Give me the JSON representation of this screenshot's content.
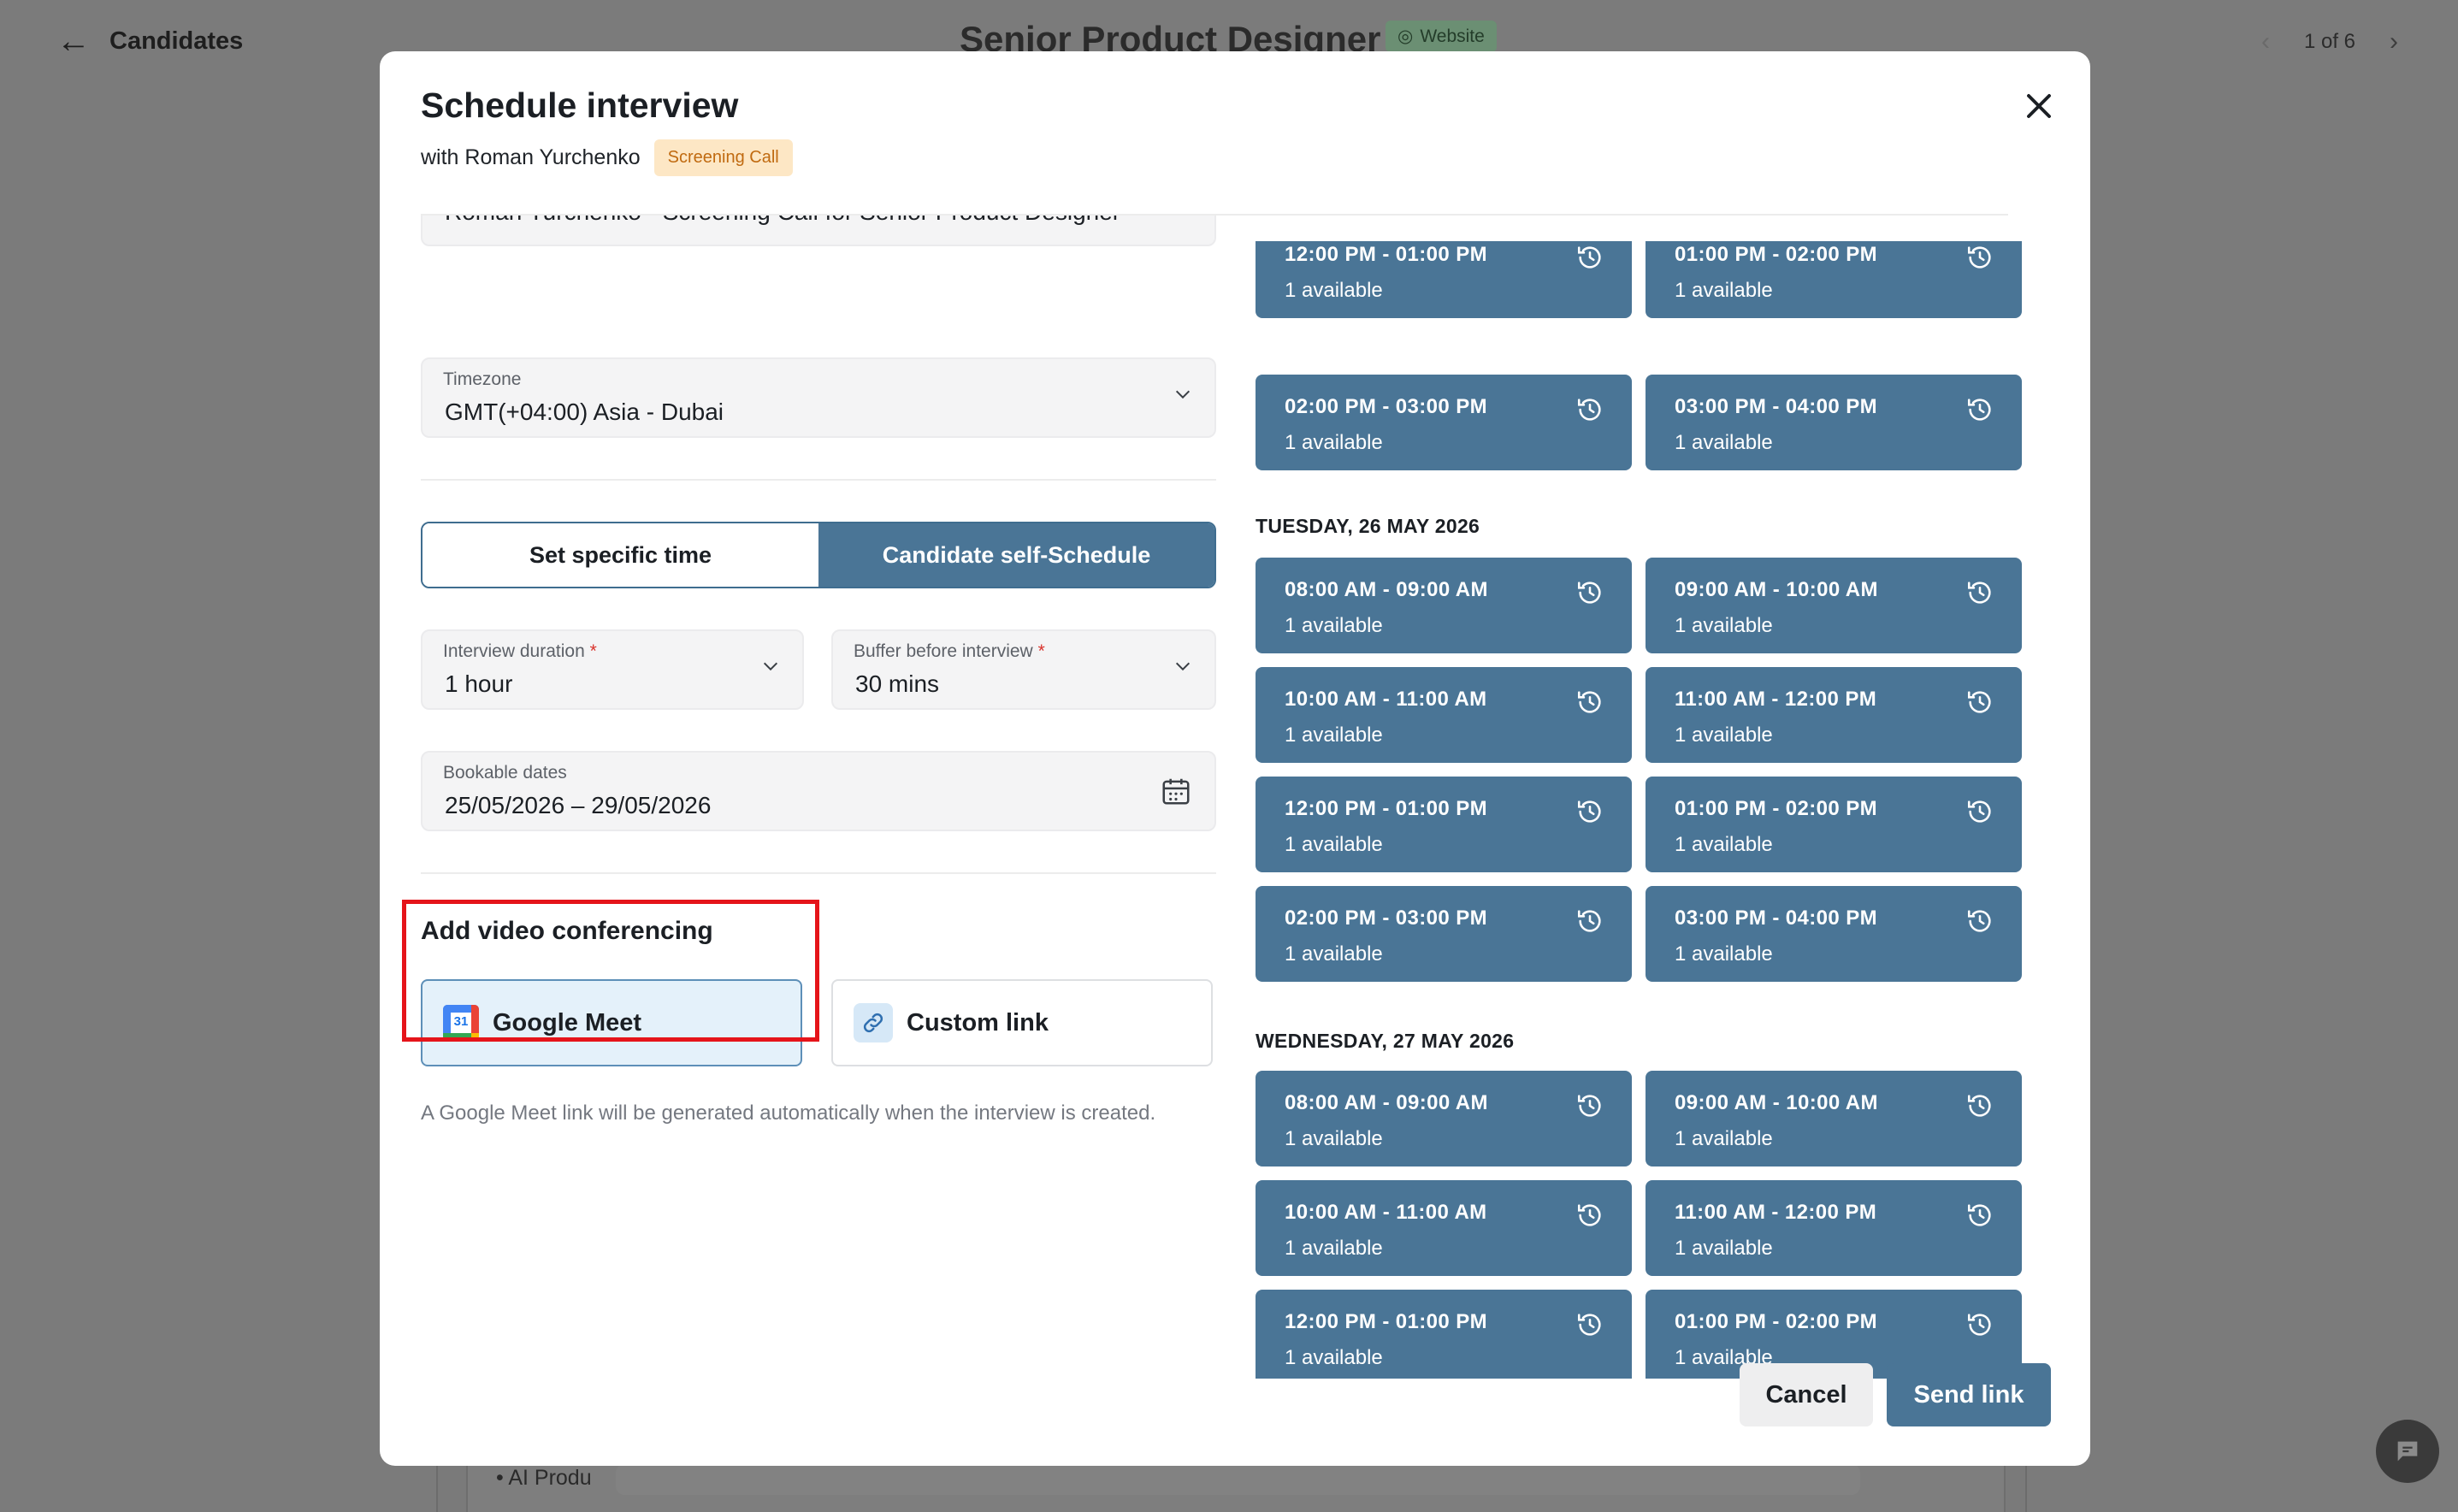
{
  "background": {
    "back_label": "Candidates",
    "page_title": "Senior Product Designer",
    "source_badge": "Website",
    "pager": "1 of 6",
    "bullet_text": "AI Produ"
  },
  "modal": {
    "title": "Schedule interview",
    "with_text": "with Roman Yurchenko",
    "stage_tag": "Screening Call",
    "subject_value": "Roman Yurchenko - Screening Call for Senior Product Designer",
    "timezone": {
      "label": "Timezone",
      "value": "GMT(+04:00) Asia - Dubai"
    },
    "mode_options": {
      "specific": "Set specific time",
      "self": "Candidate self-Schedule",
      "selected": "self"
    },
    "duration": {
      "label": "Interview duration",
      "required": "*",
      "value": "1 hour"
    },
    "buffer": {
      "label": "Buffer before interview",
      "required": "*",
      "value": "30 mins"
    },
    "bookable": {
      "label": "Bookable dates",
      "value": "25/05/2026 – 29/05/2026"
    },
    "video": {
      "title": "Add video conferencing",
      "google_label": "Google Meet",
      "google_icon_text": "31",
      "custom_label": "Custom link",
      "help": "A Google Meet link will be generated automatically when the interview is created.",
      "selected": "google"
    },
    "cancel_label": "Cancel",
    "send_label": "Send link"
  },
  "slots": {
    "partial": [
      {
        "time": "12:00 PM - 01:00 PM",
        "avail": "1 available"
      },
      {
        "time": "01:00 PM - 02:00 PM",
        "avail": "1 available"
      },
      {
        "time": "02:00 PM - 03:00 PM",
        "avail": "1 available"
      },
      {
        "time": "03:00 PM - 04:00 PM",
        "avail": "1 available"
      }
    ],
    "tuesday": {
      "title": "TUESDAY, 26 MAY 2026",
      "items": [
        {
          "time": "08:00 AM - 09:00 AM",
          "avail": "1 available"
        },
        {
          "time": "09:00 AM - 10:00 AM",
          "avail": "1 available"
        },
        {
          "time": "10:00 AM - 11:00 AM",
          "avail": "1 available"
        },
        {
          "time": "11:00 AM - 12:00 PM",
          "avail": "1 available"
        },
        {
          "time": "12:00 PM - 01:00 PM",
          "avail": "1 available"
        },
        {
          "time": "01:00 PM - 02:00 PM",
          "avail": "1 available"
        },
        {
          "time": "02:00 PM - 03:00 PM",
          "avail": "1 available"
        },
        {
          "time": "03:00 PM - 04:00 PM",
          "avail": "1 available"
        }
      ]
    },
    "wednesday": {
      "title": "WEDNESDAY, 27 MAY 2026",
      "items": [
        {
          "time": "08:00 AM - 09:00 AM",
          "avail": "1 available"
        },
        {
          "time": "09:00 AM - 10:00 AM",
          "avail": "1 available"
        },
        {
          "time": "10:00 AM - 11:00 AM",
          "avail": "1 available"
        },
        {
          "time": "11:00 AM - 12:00 PM",
          "avail": "1 available"
        },
        {
          "time": "12:00 PM - 01:00 PM",
          "avail": "1 available"
        },
        {
          "time": "01:00 PM - 02:00 PM",
          "avail": "1 available"
        }
      ]
    }
  },
  "colors": {
    "accent": "#4a7596",
    "tag_bg": "#fde7c5",
    "tag_text": "#c06a10",
    "highlight": "#e5141a"
  }
}
